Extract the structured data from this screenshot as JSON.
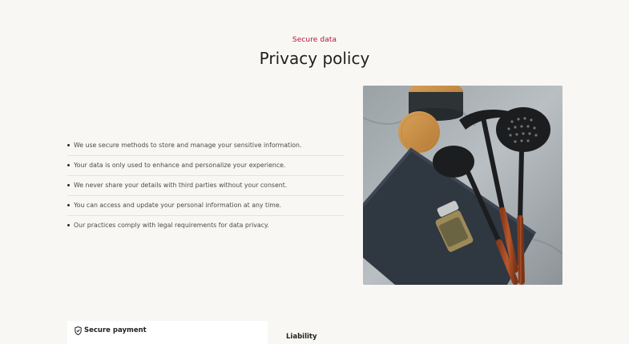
{
  "header": {
    "eyebrow": "Secure data",
    "title": "Privacy policy"
  },
  "privacy_points": [
    "We use secure methods to store and manage your sensitive information.",
    "Your data is only used to enhance and personalize your experience.",
    "We never share your details with third parties without your consent.",
    "You can access and update your personal information at any time.",
    "Our practices comply with legal requirements for data privacy."
  ],
  "image": {
    "icon": "kitchen-utensils-photo"
  },
  "accordion": {
    "secure_payment_label": "Secure payment",
    "secure_payment_icon": "shield-check-icon",
    "liability_label": "Liability"
  },
  "colors": {
    "accent": "#b5133a",
    "background": "#f9f7f4"
  }
}
